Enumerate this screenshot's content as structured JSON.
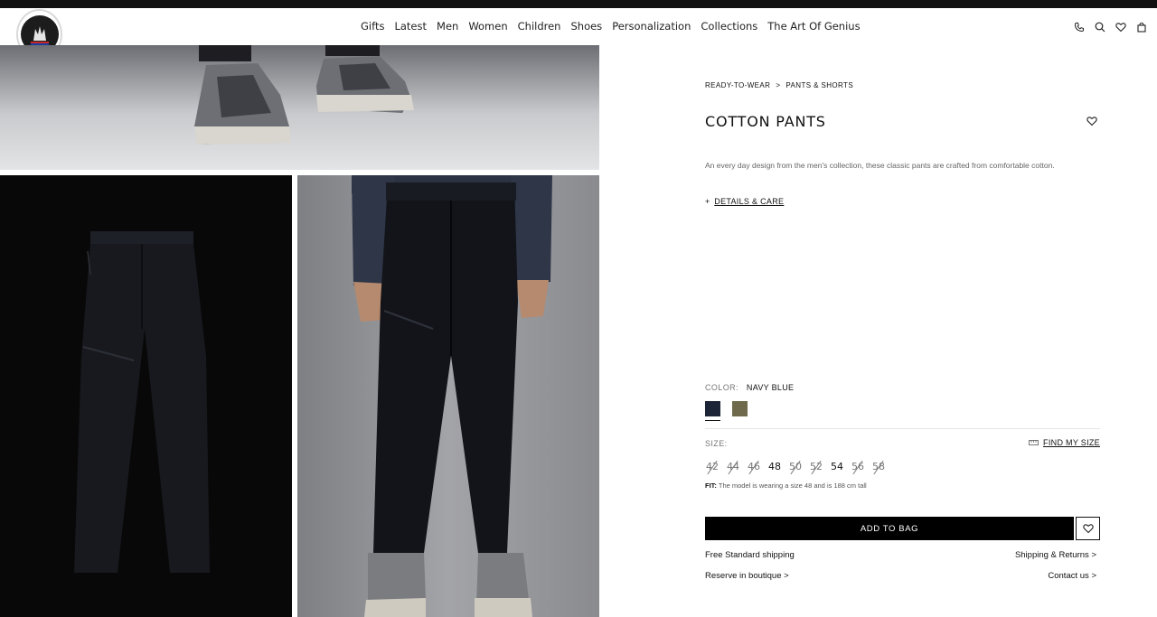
{
  "colors": {
    "brand": "#000000",
    "navy_swatch": "#1c2437",
    "olive_swatch": "#6f6a4b"
  },
  "header": {
    "logo_text": "MONCLER",
    "nav": [
      "Gifts",
      "Latest",
      "Men",
      "Women",
      "Children",
      "Shoes",
      "Personalization",
      "Collections",
      "The Art Of Genius"
    ],
    "icons": [
      "phone-icon",
      "search-icon",
      "heart-icon",
      "bag-icon"
    ]
  },
  "gallery": {
    "images": [
      "shoes-closeup-image",
      "pants-flat-image",
      "model-wearing-pants-image"
    ]
  },
  "product": {
    "breadcrumb": [
      "READY-TO-WEAR",
      "PANTS & SHORTS"
    ],
    "breadcrumb_sep": ">",
    "title": "COTTON PANTS",
    "description": "An every day design from the men's collection, these classic pants are crafted from comfortable cotton.",
    "details_plus": "+",
    "details_label": "DETAILS & CARE",
    "color_label": "COLOR:",
    "color_value": "NAVY BLUE",
    "swatches": [
      "navy",
      "olive"
    ],
    "size_label": "SIZE:",
    "find_size": "FIND MY SIZE",
    "sizes": [
      {
        "label": "42",
        "available": false
      },
      {
        "label": "44",
        "available": false
      },
      {
        "label": "46",
        "available": false
      },
      {
        "label": "48",
        "available": true
      },
      {
        "label": "50",
        "available": false
      },
      {
        "label": "52",
        "available": false
      },
      {
        "label": "54",
        "available": true
      },
      {
        "label": "56",
        "available": false
      },
      {
        "label": "58",
        "available": false
      }
    ],
    "fit_label": "FIT:",
    "fit_text": "The model is wearing a size 48 and is 188 cm tall",
    "add_to_bag": "ADD TO BAG",
    "free_shipping": "Free Standard shipping",
    "shipping_returns": "Shipping & Returns",
    "reserve": "Reserve in boutique",
    "contact": "Contact us",
    "chevron": ">"
  }
}
